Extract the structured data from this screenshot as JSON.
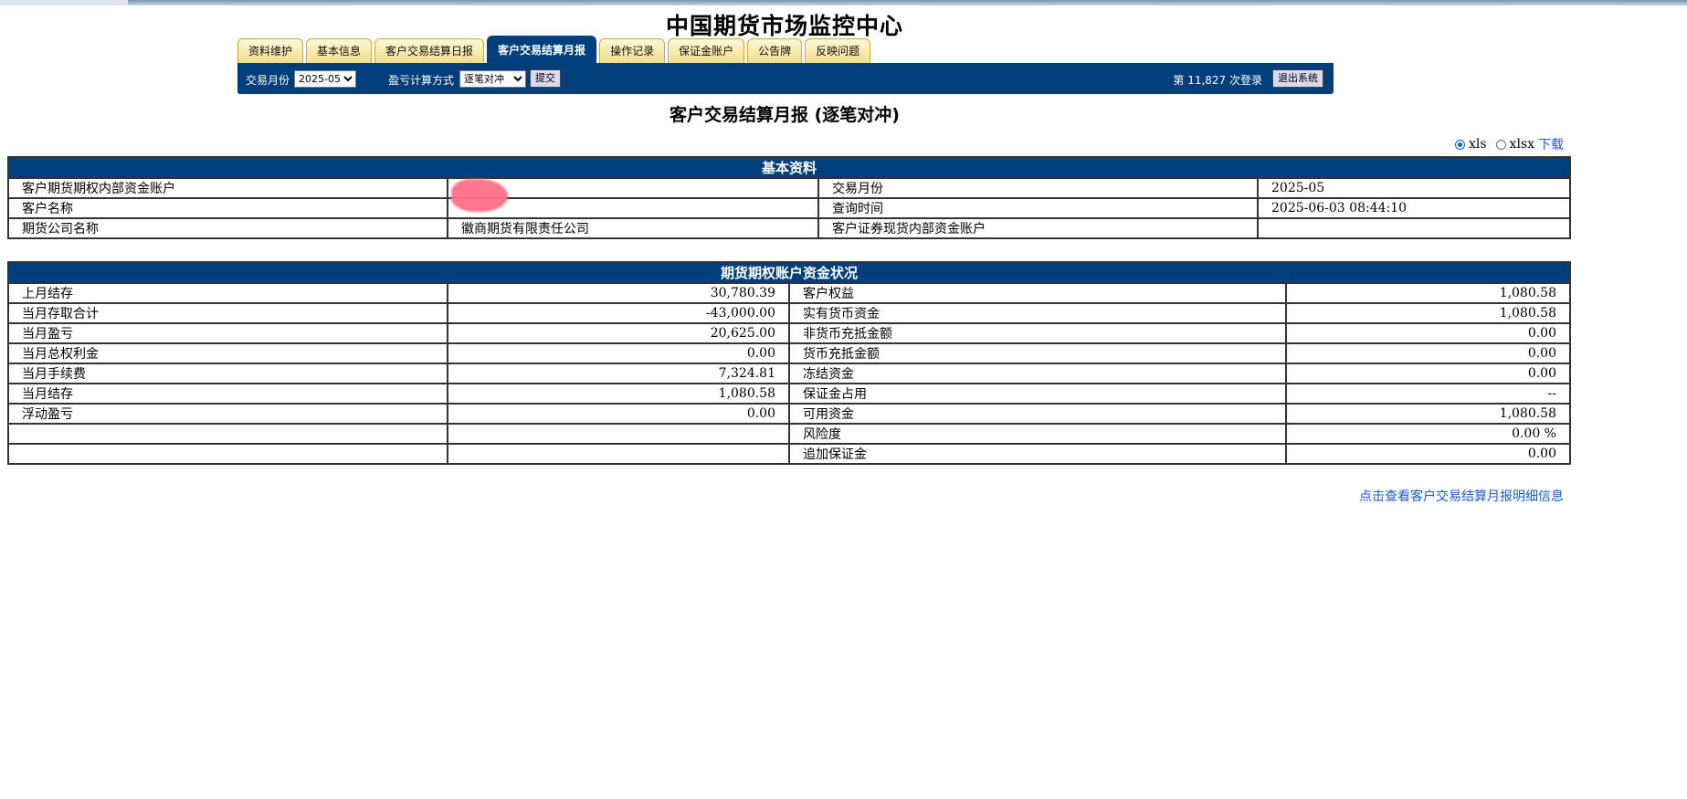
{
  "site_title": "中国期货市场监控中心",
  "tabs": [
    {
      "label": "资料维护"
    },
    {
      "label": "基本信息"
    },
    {
      "label": "客户交易结算日报"
    },
    {
      "label": "客户交易结算月报",
      "active": true
    },
    {
      "label": "操作记录"
    },
    {
      "label": "保证金账户"
    },
    {
      "label": "公告牌"
    },
    {
      "label": "反映问题"
    }
  ],
  "toolbar": {
    "month_label": "交易月份",
    "month_value": "2025-05",
    "calc_label": "盈亏计算方式",
    "calc_value": "逐笔对冲",
    "submit_label": "提交",
    "login_count_text": "第 11,827 次登录",
    "logout_label": "退出系统"
  },
  "report_title": "客户交易结算月报 (逐笔对冲)",
  "export": {
    "options": [
      {
        "label": "xls",
        "selected": true
      },
      {
        "label": "xlsx",
        "selected": false
      }
    ],
    "download_label": "下载"
  },
  "basic_info": {
    "header": "基本资料",
    "rows": [
      [
        "客户期货期权内部资金账户",
        "",
        "交易月份",
        "2025-05"
      ],
      [
        "客户名称",
        "",
        "查询时间",
        "2025-06-03 08:44:10"
      ],
      [
        "期货公司名称",
        "徽商期货有限责任公司",
        "客户证券现货内部资金账户",
        ""
      ]
    ]
  },
  "funds": {
    "header": "期货期权账户资金状况",
    "rows": [
      [
        "上月结存",
        "30,780.39",
        "客户权益",
        "1,080.58"
      ],
      [
        "当月存取合计",
        "-43,000.00",
        "实有货币资金",
        "1,080.58"
      ],
      [
        "当月盈亏",
        "20,625.00",
        "非货币充抵金额",
        "0.00"
      ],
      [
        "当月总权利金",
        "0.00",
        "货币充抵金额",
        "0.00"
      ],
      [
        "当月手续费",
        "7,324.81",
        "冻结资金",
        "0.00"
      ],
      [
        "当月结存",
        "1,080.58",
        "保证金占用",
        "--"
      ],
      [
        "浮动盈亏",
        "0.00",
        "可用资金",
        "1,080.58"
      ],
      [
        "",
        "",
        "风险度",
        "0.00 %"
      ],
      [
        "",
        "",
        "追加保证金",
        "0.00"
      ]
    ]
  },
  "detail_link": "点击查看客户交易结算月报明细信息"
}
